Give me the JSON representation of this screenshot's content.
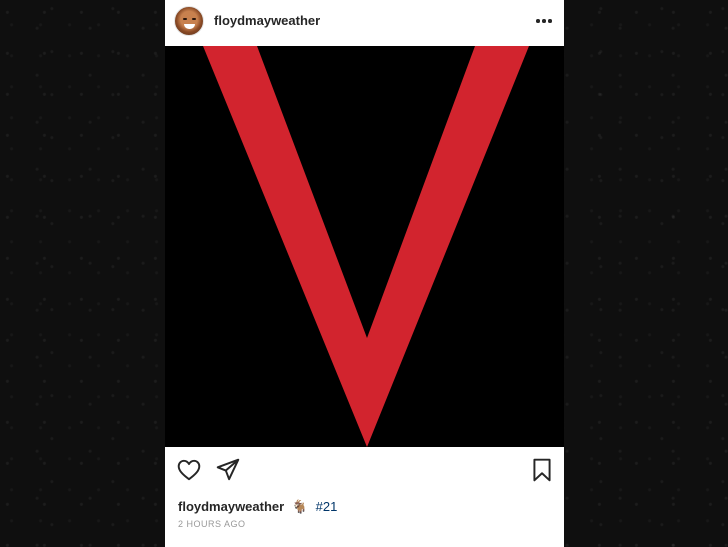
{
  "post": {
    "username": "floydmayweather",
    "caption": {
      "username": "floydmayweather",
      "emoji": "🐐",
      "hashtag": "#21"
    },
    "timestamp": "2 HOURS AGO"
  },
  "icons": {
    "more": "more-options-icon",
    "like": "heart-icon",
    "share": "send-icon",
    "save": "bookmark-icon"
  },
  "colors": {
    "media_background": "#000000",
    "v_red": "#d2242e",
    "hashtag": "#003569"
  }
}
